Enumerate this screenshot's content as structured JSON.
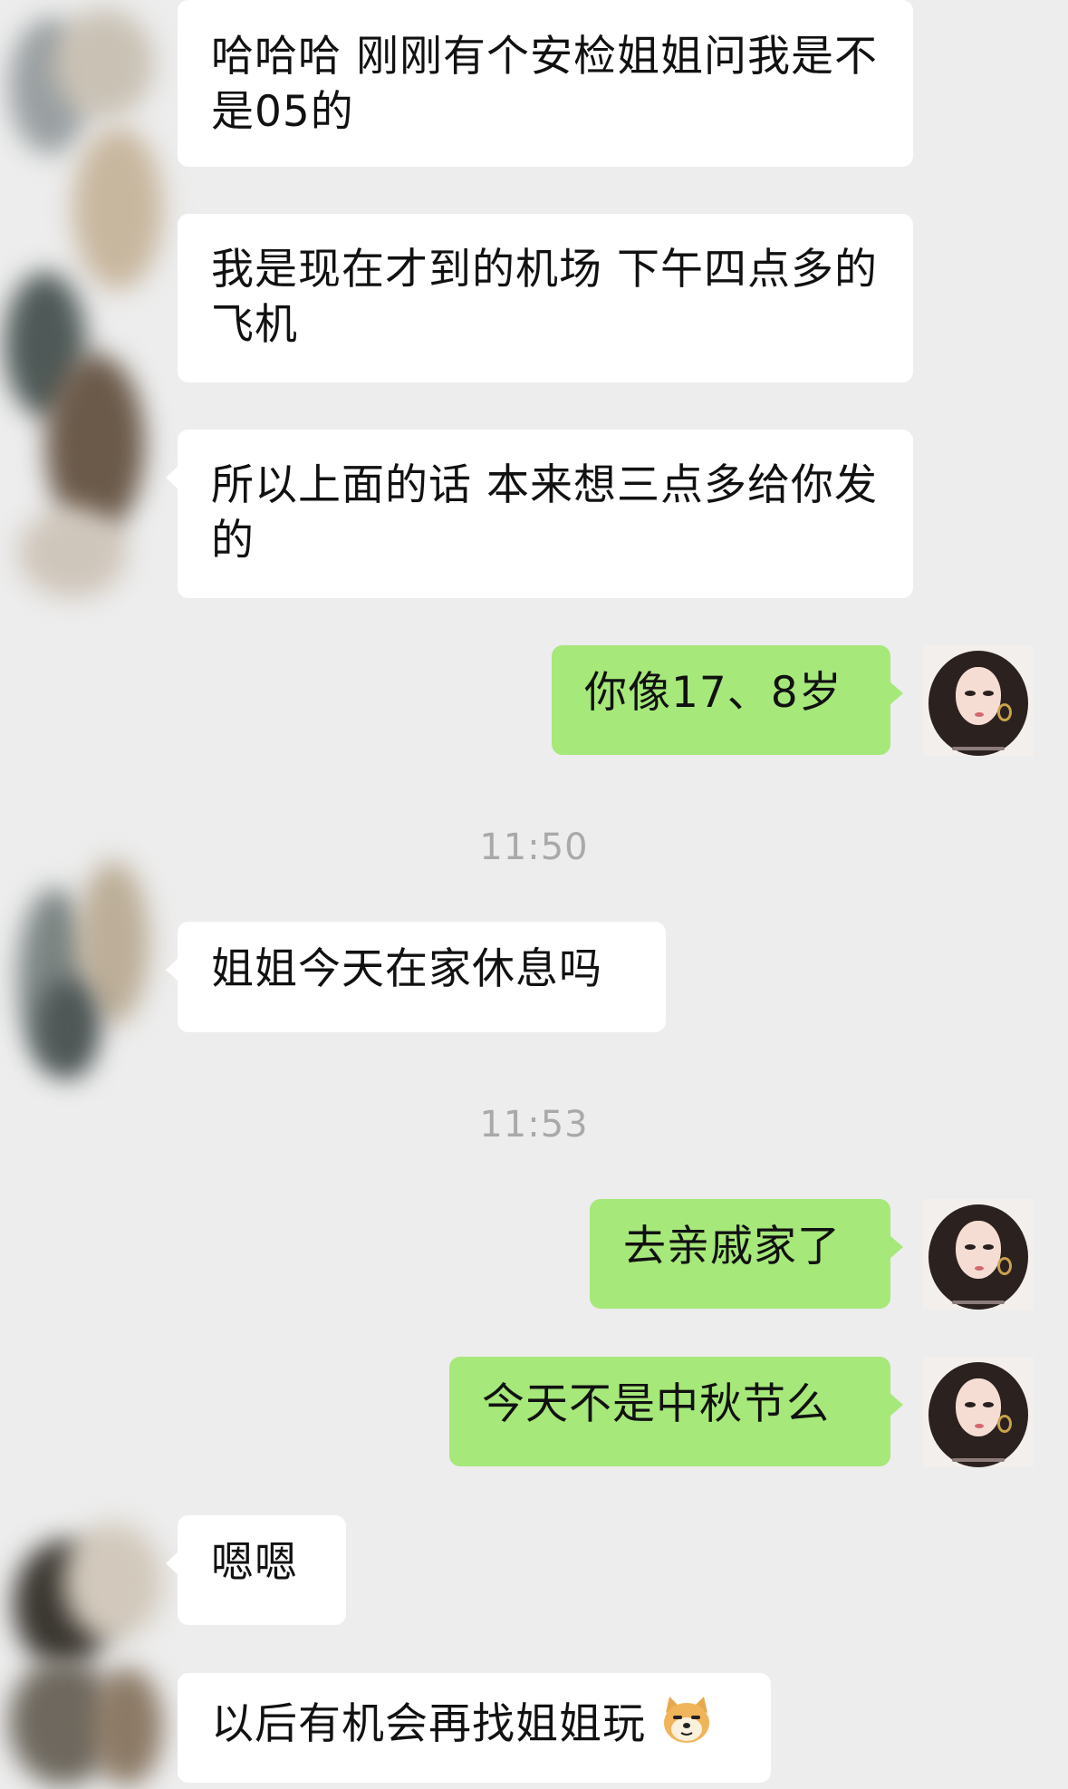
{
  "messages": [
    {
      "side": "in",
      "text": "哈哈哈 刚刚有个安检姐姐问我是不是05的"
    },
    {
      "side": "in",
      "text": "我是现在才到的机场 下午四点多的飞机"
    },
    {
      "side": "in",
      "text": "所以上面的话 本来想三点多给你发的"
    },
    {
      "side": "out",
      "text": "你像17、8岁"
    },
    {
      "side": "in",
      "text": "姐姐今天在家休息吗"
    },
    {
      "side": "out",
      "text": "去亲戚家了"
    },
    {
      "side": "out",
      "text": "今天不是中秋节么"
    },
    {
      "side": "in",
      "text": "嗯嗯"
    },
    {
      "side": "in",
      "text": "以后有机会再找姐姐玩",
      "emoji": "doge-emoji-icon"
    }
  ],
  "timestamps": [
    "11:50",
    "11:53"
  ],
  "colors": {
    "background": "#ededed",
    "incoming_bubble": "#ffffff",
    "outgoing_bubble": "#a6e87a",
    "timestamp_text": "#a9a9a9"
  },
  "avatars": {
    "self": "girl-portrait-avatar",
    "other": "blurred-avatar"
  }
}
